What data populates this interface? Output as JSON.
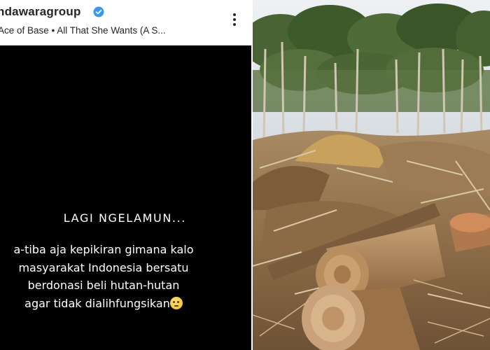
{
  "story": {
    "account": {
      "username": "ndawaragroup",
      "verified_icon": "verified-badge-icon",
      "verified_color": "#3897f0"
    },
    "music": "Ace of Base • All That She Wants (A S...",
    "menu_icon": "more-options-icon",
    "title": "LAGI NGELAMUN...",
    "text_lines": [
      "a-tiba aja kepikiran gimana kalo",
      "masyarakat Indonesia bersatu",
      "berdonasi beli hutan-hutan",
      "agar tidak dialihfungsikan"
    ],
    "emoji_icon": "thinking-face-icon",
    "background": "#000000"
  },
  "photo": {
    "subject": "deforestation-photo",
    "colors": {
      "sky": "#e4e8ec",
      "canopy": "#3f5a2c",
      "ground": "#9a7a52",
      "log": "#b48c62"
    }
  }
}
